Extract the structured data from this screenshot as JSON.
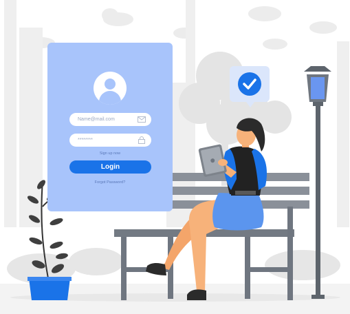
{
  "login": {
    "email_placeholder": "Name@mail.com",
    "password_placeholder": "********",
    "signup_text": "Sign up now",
    "login_label": "Login",
    "forgot_text": "Forgot Password?"
  },
  "colors": {
    "accent": "#1a73e8",
    "card": "#a8c4fb",
    "grey_scene": "#e6e6e6",
    "bench": "#6f7680"
  },
  "icons": [
    "user-icon",
    "mail-icon",
    "lock-icon",
    "checkmark-icon",
    "street-lamp",
    "plant",
    "tablet"
  ]
}
